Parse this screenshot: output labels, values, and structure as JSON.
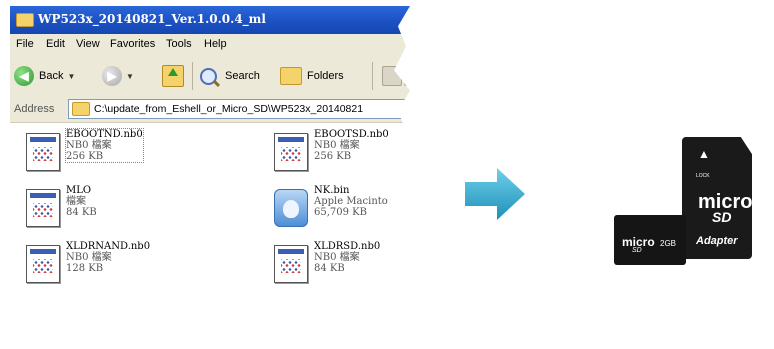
{
  "window": {
    "title": "WP523x_20140821_Ver.1.0.0.4_ml"
  },
  "menu": [
    "File",
    "Edit",
    "View",
    "Favorites",
    "Tools",
    "Help"
  ],
  "toolbar": {
    "back_label": "Back",
    "search_label": "Search",
    "folders_label": "Folders"
  },
  "address": {
    "label": "Address",
    "value": "C:\\update_from_Eshell_or_Micro_SD\\WP523x_20140821"
  },
  "files": [
    {
      "name": "EBOOTND.nb0",
      "type": "NB0 檔案",
      "size": "256 KB",
      "icon": "document-icon"
    },
    {
      "name": "EBOOTSD.nb0",
      "type": "NB0 檔案",
      "size": "256 KB",
      "icon": "document-icon"
    },
    {
      "name": "MLO",
      "type": "檔案",
      "size": "84 KB",
      "icon": "document-icon"
    },
    {
      "name": "NK.bin",
      "type": "Apple Macinto",
      "size": "65,709 KB",
      "icon": "apple-file-icon"
    },
    {
      "name": "XLDRNAND.nb0",
      "type": "NB0 檔案",
      "size": "128 KB",
      "icon": "document-icon"
    },
    {
      "name": "XLDRSD.nb0",
      "type": "NB0 檔案",
      "size": "84 KB",
      "icon": "document-icon"
    }
  ],
  "card": {
    "adapter_brand_top": "LOCK",
    "adapter_micro": "micro",
    "adapter_sd": "SD",
    "adapter_label": "Adapter",
    "microsd_micro": "micro",
    "microsd_sd": "SD",
    "microsd_capacity": "2GB"
  },
  "colors": {
    "titlebar": "#1b4fc2",
    "arrow": "#2aa3c9"
  }
}
